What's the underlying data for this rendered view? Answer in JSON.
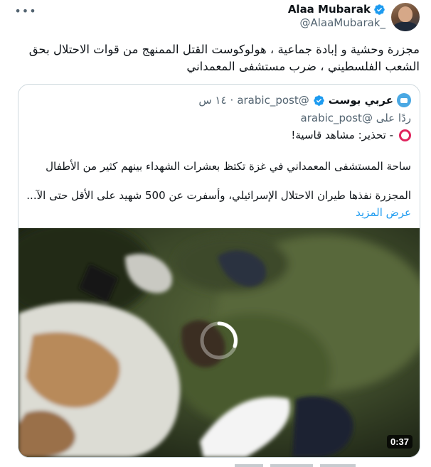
{
  "tweet": {
    "author": {
      "display_name": "Alaa Mubarak",
      "handle": "@AlaaMubarak_",
      "verified": true
    },
    "more_icon": "more-dots-icon",
    "text": "مجزرة وحشية و إبادة جماعية ، هولوكوست القتل الممنهج من قوات الاحتلال بحق الشعب الفلسطيني ، ضرب مستشفى المعمداني"
  },
  "quote": {
    "author": {
      "display_name": "عربي بوست",
      "handle": "@arabic_post",
      "verified": true
    },
    "dot": "·",
    "time": "١٤ س",
    "reply_prefix": "ردًا على",
    "reply_to": "@arabic_post",
    "warning": "- تحذير: مشاهد قاسية!",
    "line1": "ساحة المستشفى المعمداني في غزة تكتظ بعشرات الشهداء بينهم كثير من الأطفال",
    "line2": "المجزرة نفذها طيران الاحتلال الإسرائيلي، وأسفرت عن 500 شهيد على الأقل حتى الآ...",
    "show_more": "عرض المزيد",
    "media": {
      "type": "video",
      "state": "loading",
      "duration": "0:37"
    }
  },
  "colors": {
    "text": "#0f1419",
    "secondary": "#536471",
    "link": "#1d9bf0",
    "verified": "#1d9bf0",
    "warning_ring": "#e0245e",
    "border": "#cfd9de"
  }
}
